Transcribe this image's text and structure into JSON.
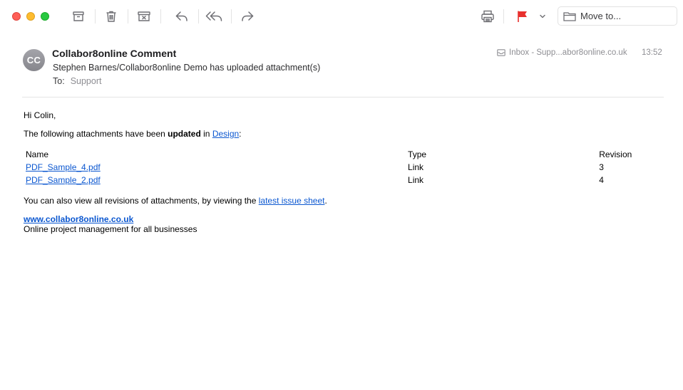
{
  "toolbar": {
    "window_controls": [
      "close",
      "minimize",
      "zoom"
    ],
    "icons": [
      "archive-icon",
      "trash-icon",
      "junk-icon",
      "reply-icon",
      "reply-all-icon",
      "forward-icon",
      "print-icon",
      "flag-icon",
      "chevron-down-icon",
      "folder-icon"
    ],
    "move_to_placeholder": "Move to...",
    "flag_color": "#e8302d"
  },
  "header": {
    "avatar_initials": "CC",
    "sender": "Collabor8online Comment",
    "subject": "Stephen Barnes/Collabor8online Demo has uploaded attachment(s)",
    "to_label": "To:",
    "to_value": "Support",
    "mailbox": "Inbox - Supp...abor8online.co.uk",
    "time": "13:52"
  },
  "body": {
    "greeting": "Hi Colin,",
    "intro_prefix": "The following attachments have been ",
    "intro_bold": "updated",
    "intro_mid": " in ",
    "intro_link": "Design",
    "intro_suffix": ":",
    "table": {
      "headers": [
        "Name",
        "Type",
        "Revision"
      ],
      "rows": [
        {
          "name": "PDF_Sample_4.pdf",
          "type": "Link",
          "revision": "3"
        },
        {
          "name": "PDF_Sample_2.pdf",
          "type": "Link",
          "revision": "4"
        }
      ]
    },
    "revisions_prefix": "You can also view all revisions of attachments, by viewing the ",
    "revisions_link": "latest issue sheet",
    "revisions_suffix": ".",
    "footer_link": "www.collabor8online.co.uk",
    "footer_tagline": "Online project management for all businesses"
  },
  "colors": {
    "link": "#0b57d0",
    "close": "#ff5f57",
    "minimize": "#febc2e",
    "zoom": "#28c840"
  }
}
